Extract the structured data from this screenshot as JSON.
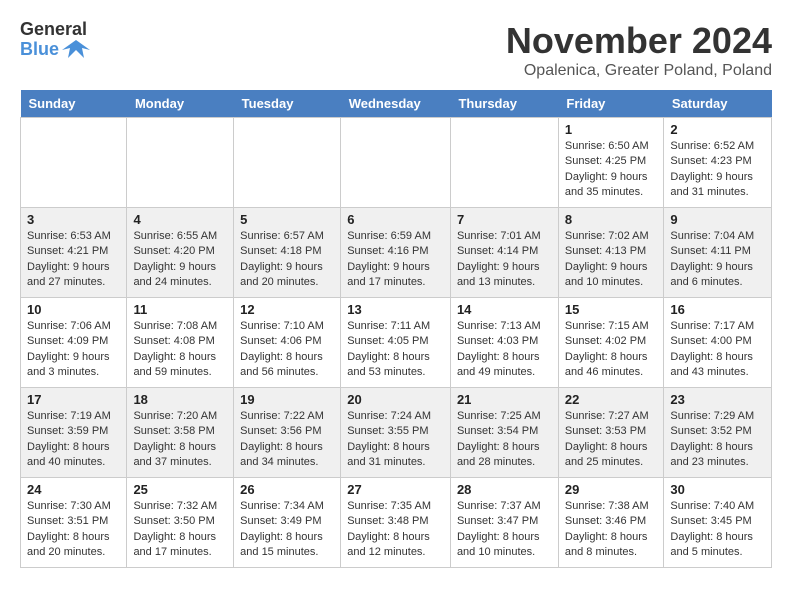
{
  "logo": {
    "text_general": "General",
    "text_blue": "Blue"
  },
  "title": "November 2024",
  "location": "Opalenica, Greater Poland, Poland",
  "days_of_week": [
    "Sunday",
    "Monday",
    "Tuesday",
    "Wednesday",
    "Thursday",
    "Friday",
    "Saturday"
  ],
  "weeks": [
    [
      {
        "day": "",
        "sunrise": "",
        "sunset": "",
        "daylight": ""
      },
      {
        "day": "",
        "sunrise": "",
        "sunset": "",
        "daylight": ""
      },
      {
        "day": "",
        "sunrise": "",
        "sunset": "",
        "daylight": ""
      },
      {
        "day": "",
        "sunrise": "",
        "sunset": "",
        "daylight": ""
      },
      {
        "day": "",
        "sunrise": "",
        "sunset": "",
        "daylight": ""
      },
      {
        "day": "1",
        "sunrise": "Sunrise: 6:50 AM",
        "sunset": "Sunset: 4:25 PM",
        "daylight": "Daylight: 9 hours and 35 minutes."
      },
      {
        "day": "2",
        "sunrise": "Sunrise: 6:52 AM",
        "sunset": "Sunset: 4:23 PM",
        "daylight": "Daylight: 9 hours and 31 minutes."
      }
    ],
    [
      {
        "day": "3",
        "sunrise": "Sunrise: 6:53 AM",
        "sunset": "Sunset: 4:21 PM",
        "daylight": "Daylight: 9 hours and 27 minutes."
      },
      {
        "day": "4",
        "sunrise": "Sunrise: 6:55 AM",
        "sunset": "Sunset: 4:20 PM",
        "daylight": "Daylight: 9 hours and 24 minutes."
      },
      {
        "day": "5",
        "sunrise": "Sunrise: 6:57 AM",
        "sunset": "Sunset: 4:18 PM",
        "daylight": "Daylight: 9 hours and 20 minutes."
      },
      {
        "day": "6",
        "sunrise": "Sunrise: 6:59 AM",
        "sunset": "Sunset: 4:16 PM",
        "daylight": "Daylight: 9 hours and 17 minutes."
      },
      {
        "day": "7",
        "sunrise": "Sunrise: 7:01 AM",
        "sunset": "Sunset: 4:14 PM",
        "daylight": "Daylight: 9 hours and 13 minutes."
      },
      {
        "day": "8",
        "sunrise": "Sunrise: 7:02 AM",
        "sunset": "Sunset: 4:13 PM",
        "daylight": "Daylight: 9 hours and 10 minutes."
      },
      {
        "day": "9",
        "sunrise": "Sunrise: 7:04 AM",
        "sunset": "Sunset: 4:11 PM",
        "daylight": "Daylight: 9 hours and 6 minutes."
      }
    ],
    [
      {
        "day": "10",
        "sunrise": "Sunrise: 7:06 AM",
        "sunset": "Sunset: 4:09 PM",
        "daylight": "Daylight: 9 hours and 3 minutes."
      },
      {
        "day": "11",
        "sunrise": "Sunrise: 7:08 AM",
        "sunset": "Sunset: 4:08 PM",
        "daylight": "Daylight: 8 hours and 59 minutes."
      },
      {
        "day": "12",
        "sunrise": "Sunrise: 7:10 AM",
        "sunset": "Sunset: 4:06 PM",
        "daylight": "Daylight: 8 hours and 56 minutes."
      },
      {
        "day": "13",
        "sunrise": "Sunrise: 7:11 AM",
        "sunset": "Sunset: 4:05 PM",
        "daylight": "Daylight: 8 hours and 53 minutes."
      },
      {
        "day": "14",
        "sunrise": "Sunrise: 7:13 AM",
        "sunset": "Sunset: 4:03 PM",
        "daylight": "Daylight: 8 hours and 49 minutes."
      },
      {
        "day": "15",
        "sunrise": "Sunrise: 7:15 AM",
        "sunset": "Sunset: 4:02 PM",
        "daylight": "Daylight: 8 hours and 46 minutes."
      },
      {
        "day": "16",
        "sunrise": "Sunrise: 7:17 AM",
        "sunset": "Sunset: 4:00 PM",
        "daylight": "Daylight: 8 hours and 43 minutes."
      }
    ],
    [
      {
        "day": "17",
        "sunrise": "Sunrise: 7:19 AM",
        "sunset": "Sunset: 3:59 PM",
        "daylight": "Daylight: 8 hours and 40 minutes."
      },
      {
        "day": "18",
        "sunrise": "Sunrise: 7:20 AM",
        "sunset": "Sunset: 3:58 PM",
        "daylight": "Daylight: 8 hours and 37 minutes."
      },
      {
        "day": "19",
        "sunrise": "Sunrise: 7:22 AM",
        "sunset": "Sunset: 3:56 PM",
        "daylight": "Daylight: 8 hours and 34 minutes."
      },
      {
        "day": "20",
        "sunrise": "Sunrise: 7:24 AM",
        "sunset": "Sunset: 3:55 PM",
        "daylight": "Daylight: 8 hours and 31 minutes."
      },
      {
        "day": "21",
        "sunrise": "Sunrise: 7:25 AM",
        "sunset": "Sunset: 3:54 PM",
        "daylight": "Daylight: 8 hours and 28 minutes."
      },
      {
        "day": "22",
        "sunrise": "Sunrise: 7:27 AM",
        "sunset": "Sunset: 3:53 PM",
        "daylight": "Daylight: 8 hours and 25 minutes."
      },
      {
        "day": "23",
        "sunrise": "Sunrise: 7:29 AM",
        "sunset": "Sunset: 3:52 PM",
        "daylight": "Daylight: 8 hours and 23 minutes."
      }
    ],
    [
      {
        "day": "24",
        "sunrise": "Sunrise: 7:30 AM",
        "sunset": "Sunset: 3:51 PM",
        "daylight": "Daylight: 8 hours and 20 minutes."
      },
      {
        "day": "25",
        "sunrise": "Sunrise: 7:32 AM",
        "sunset": "Sunset: 3:50 PM",
        "daylight": "Daylight: 8 hours and 17 minutes."
      },
      {
        "day": "26",
        "sunrise": "Sunrise: 7:34 AM",
        "sunset": "Sunset: 3:49 PM",
        "daylight": "Daylight: 8 hours and 15 minutes."
      },
      {
        "day": "27",
        "sunrise": "Sunrise: 7:35 AM",
        "sunset": "Sunset: 3:48 PM",
        "daylight": "Daylight: 8 hours and 12 minutes."
      },
      {
        "day": "28",
        "sunrise": "Sunrise: 7:37 AM",
        "sunset": "Sunset: 3:47 PM",
        "daylight": "Daylight: 8 hours and 10 minutes."
      },
      {
        "day": "29",
        "sunrise": "Sunrise: 7:38 AM",
        "sunset": "Sunset: 3:46 PM",
        "daylight": "Daylight: 8 hours and 8 minutes."
      },
      {
        "day": "30",
        "sunrise": "Sunrise: 7:40 AM",
        "sunset": "Sunset: 3:45 PM",
        "daylight": "Daylight: 8 hours and 5 minutes."
      }
    ]
  ]
}
